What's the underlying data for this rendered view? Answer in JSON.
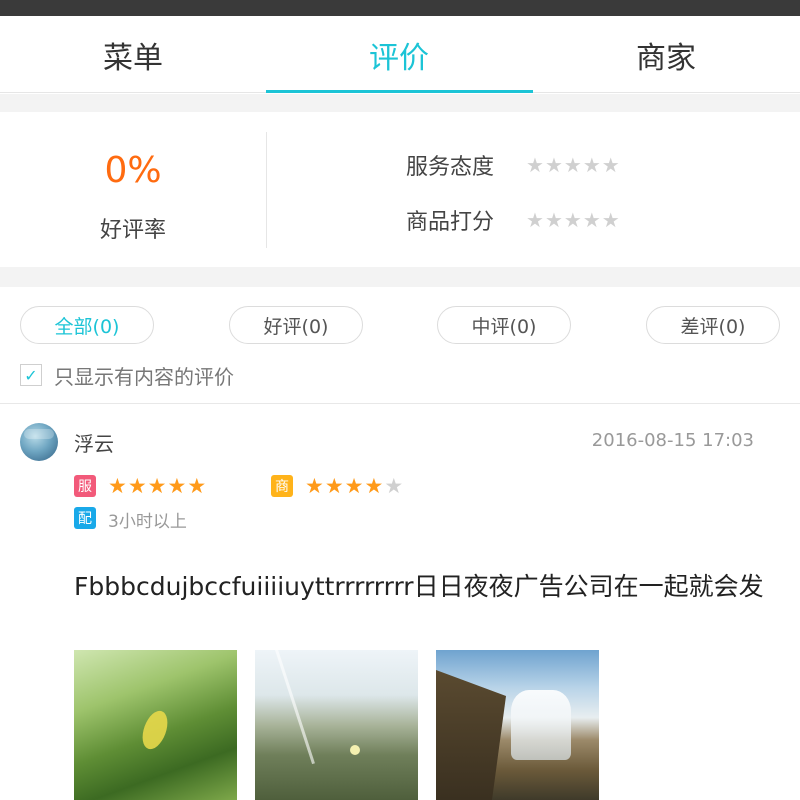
{
  "tabs": [
    {
      "label": "菜单",
      "active": false
    },
    {
      "label": "评价",
      "active": true
    },
    {
      "label": "商家",
      "active": false
    }
  ],
  "summary": {
    "good_rate": "0%",
    "good_rate_label": "好评率",
    "service_label": "服务态度",
    "service_stars": 0,
    "goods_label": "商品打分",
    "goods_stars": 0
  },
  "filters": {
    "all": "全部(0)",
    "good": "好评(0)",
    "medium": "中评(0)",
    "bad": "差评(0)",
    "active": "all",
    "only_with_content_label": "只显示有内容的评价",
    "only_with_content_checked": true
  },
  "review": {
    "username": "浮云",
    "timestamp": "2016-08-15 17:03",
    "service_badge": "服",
    "service_stars": 5,
    "goods_badge": "商",
    "goods_stars": 4,
    "delivery_badge": "配",
    "delivery_time": "3小时以上",
    "text": "Fbbbcdujbccfuiiiiuyttrrrrrrrr日日夜夜广告公司在一起就会发",
    "photos": [
      "leaf-photo",
      "grass-photo",
      "waterfall-photo"
    ]
  },
  "colors": {
    "accent": "#1cc4d6",
    "rate": "#ff6b10",
    "star_on": "#ff9a1a",
    "star_off": "#d0d0d0",
    "badge_service": "#f25a7a",
    "badge_goods": "#ffb31a",
    "badge_delivery": "#19a9e9"
  }
}
